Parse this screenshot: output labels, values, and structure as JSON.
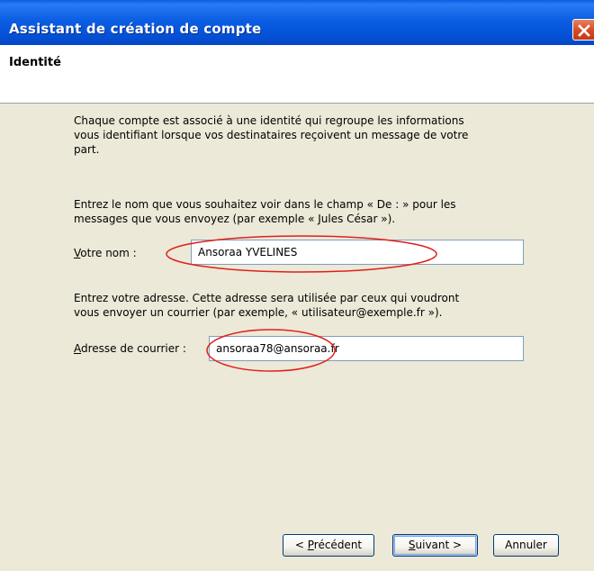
{
  "window": {
    "title": "Assistant de création de compte",
    "close_icon": "close-icon"
  },
  "header": {
    "title": "Identité"
  },
  "content": {
    "intro_lines": [
      "Chaque compte est associé à une identité qui regroupe les informations",
      "vous identifiant lorsque vos destinataires reçoivent un message de votre",
      "part."
    ],
    "name_instructions": [
      "Entrez le nom que vous souhaitez voir dans le champ « De : » pour les",
      "messages que vous envoyez (par exemple « Jules César »)."
    ],
    "name_label_accel": "V",
    "name_label_rest": "otre nom :",
    "name_value": "Ansoraa YVELINES",
    "email_instructions": [
      "Entrez votre adresse. Cette adresse sera utilisée par ceux qui voudront",
      "vous envoyer un courrier (par exemple, « utilisateur@exemple.fr »)."
    ],
    "email_label_accel": "A",
    "email_label_rest": "dresse de courrier :",
    "email_value": "ansoraa78@ansoraa.fr"
  },
  "buttons": {
    "back_prefix": "< ",
    "back_accel": "P",
    "back_rest": "récédent",
    "next_accel": "S",
    "next_rest": "uivant >",
    "cancel_label": "Annuler"
  },
  "colors": {
    "titlebar": "#0451d6",
    "annotation": "#e0201c",
    "dialog_bg": "#ece9d8"
  }
}
